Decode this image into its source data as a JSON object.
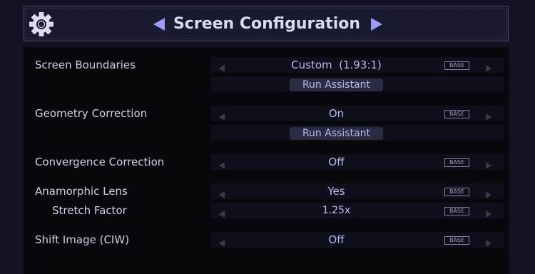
{
  "header": {
    "title": "Screen Configuration",
    "icons": {
      "settings": "gear-icon",
      "prev": "triangle-left-icon",
      "next": "triangle-right-icon"
    },
    "accent_color": "#9c9cf5"
  },
  "settings": [
    {
      "label": "Screen Boundaries",
      "value": "Custom  (1.93:1)",
      "badge": "BASE",
      "action": "Run Assistant"
    },
    {
      "label": "Geometry Correction",
      "value": "On",
      "badge": "BASE",
      "action": "Run Assistant"
    },
    {
      "label": "Convergence Correction",
      "value": "Off",
      "badge": "BASE"
    },
    {
      "label": "Anamorphic Lens",
      "value": "Yes",
      "badge": "BASE"
    },
    {
      "label": "Stretch Factor",
      "value": "1.25x",
      "badge": "BASE"
    },
    {
      "label": "Shift Image (CIW)",
      "value": "Off",
      "badge": "BASE"
    }
  ]
}
